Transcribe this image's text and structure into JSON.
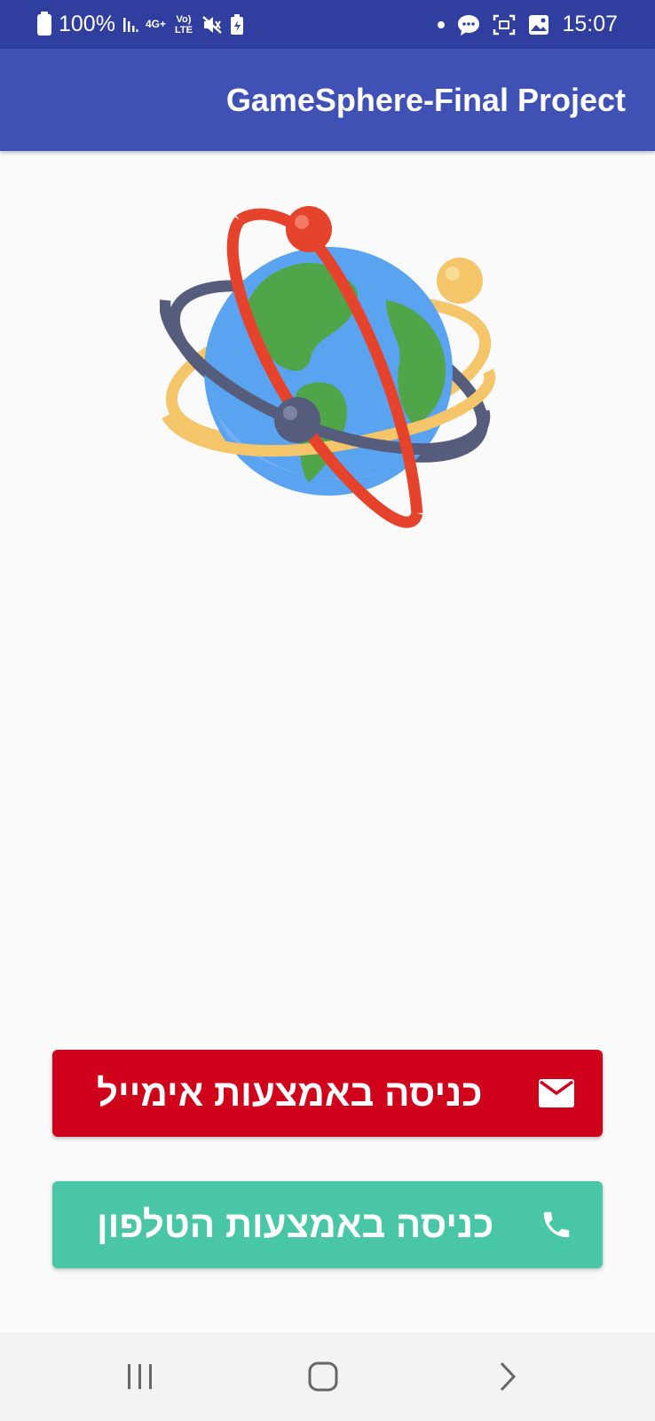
{
  "status_bar": {
    "battery_level": "100%",
    "network_type": "4G+",
    "volte_label": "Vo) LTE",
    "time": "15:07",
    "left_icons": [
      "battery-icon",
      "signal-icon",
      "network-icon",
      "volte-icon",
      "mute-icon",
      "battery-saver-icon"
    ],
    "right_icons": [
      "notification-dot-icon",
      "message-icon",
      "screenshot-icon",
      "gallery-icon"
    ]
  },
  "app_bar": {
    "title": "GameSphere-Final Project",
    "color": "#3f51b5"
  },
  "logo": {
    "icon": "globe-orbit-icon"
  },
  "buttons": {
    "email": {
      "label": "כניסה באמצעות אימייל",
      "icon": "email-icon",
      "color": "#d0021b"
    },
    "phone": {
      "label": "כניסה באמצעות הטלפון",
      "icon": "phone-icon",
      "color": "#48c6a5"
    }
  },
  "nav_bar": {
    "items": [
      "recents-icon",
      "home-icon",
      "back-icon"
    ]
  }
}
